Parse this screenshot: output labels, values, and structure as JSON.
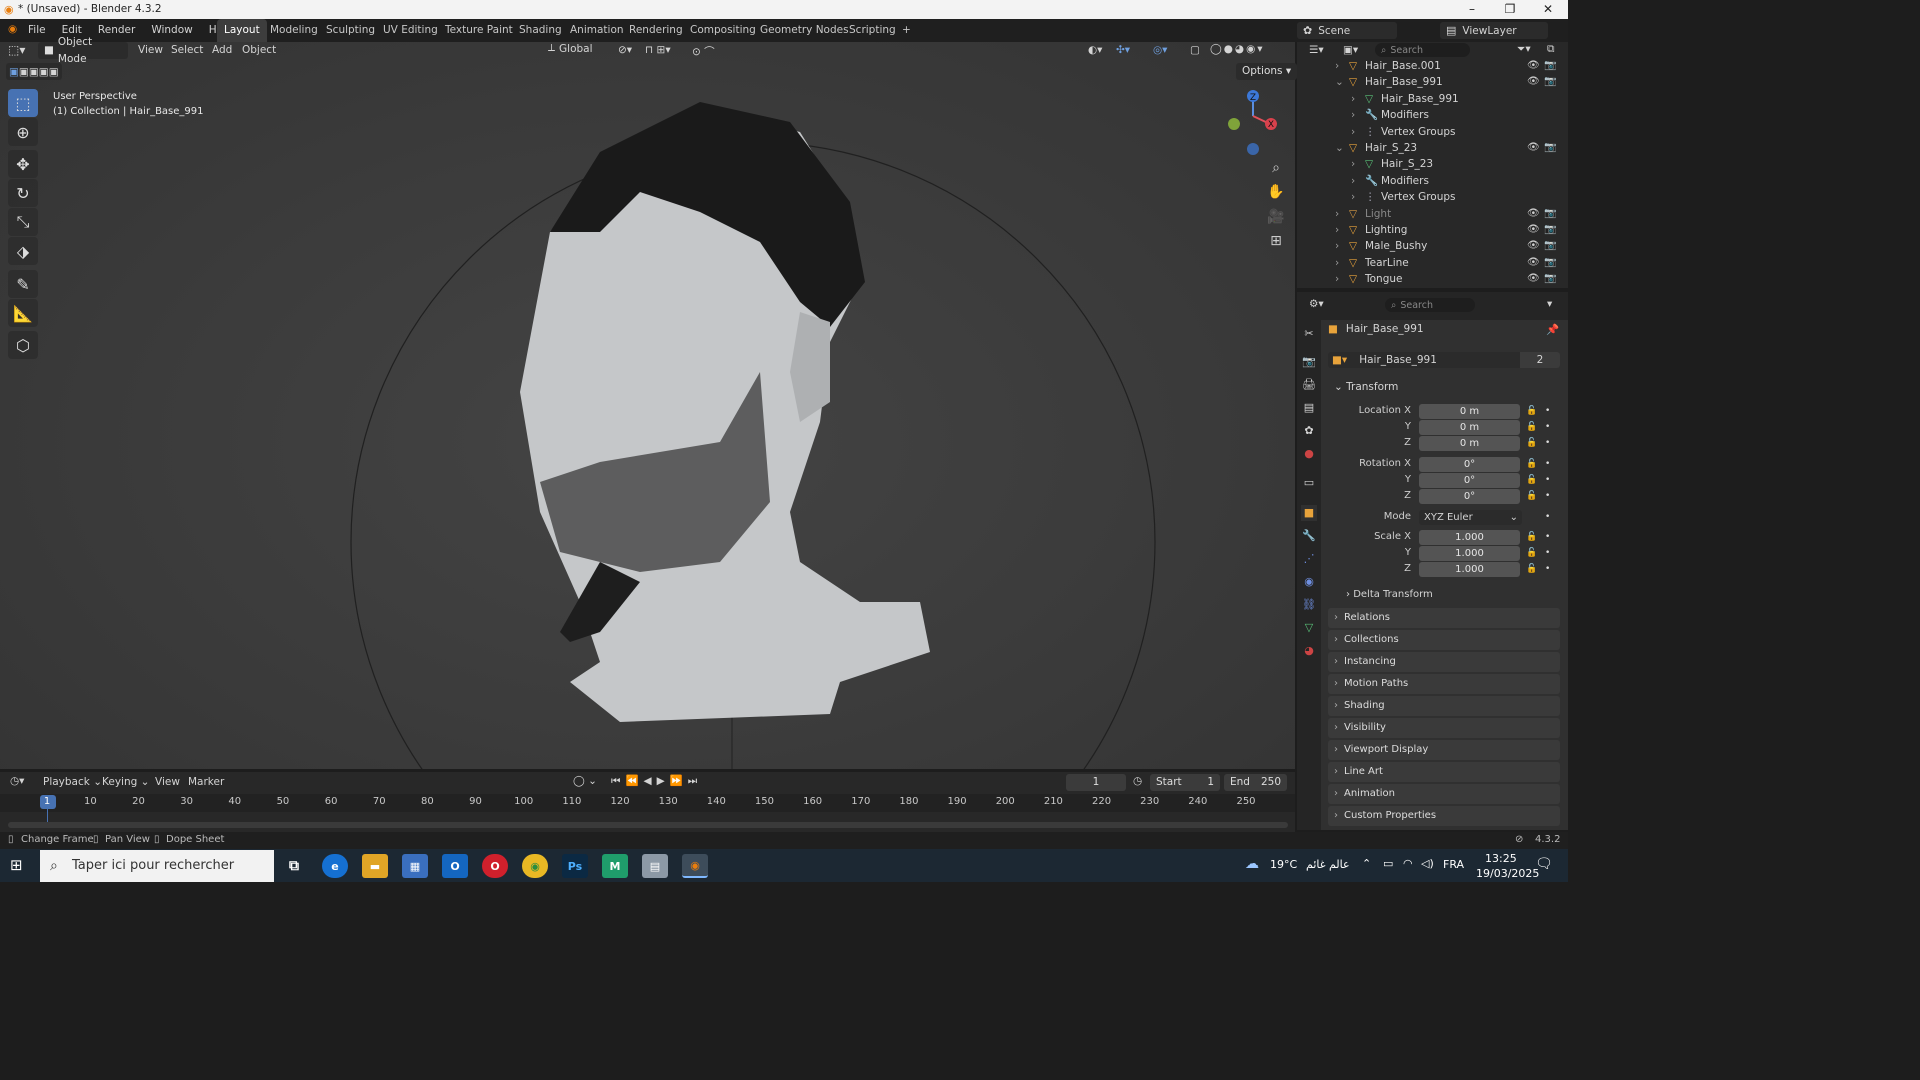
{
  "window": {
    "title": "* (Unsaved) - Blender 4.3.2",
    "minimize": "–",
    "maximize": "❐",
    "close": "✕"
  },
  "menu": [
    "File",
    "Edit",
    "Render",
    "Window",
    "Help"
  ],
  "workspaces": [
    "Layout",
    "Modeling",
    "Sculpting",
    "UV Editing",
    "Texture Paint",
    "Shading",
    "Animation",
    "Rendering",
    "Compositing",
    "Geometry Nodes",
    "Scripting",
    "+"
  ],
  "scene": {
    "name": "Scene",
    "viewlayer": "ViewLayer"
  },
  "viewport": {
    "mode": "Object Mode",
    "menus": [
      "View",
      "Select",
      "Add",
      "Object"
    ],
    "orientation": "Global",
    "options": "Options",
    "perspective": "User Perspective",
    "collection": "(1) Collection | Hair_Base_991",
    "gizmo": {
      "z": "Z",
      "x": "X"
    }
  },
  "outliner": {
    "search_placeholder": "Search",
    "rows": [
      {
        "label": "Hair_Base.001",
        "indent": 1,
        "expand": "›",
        "color": "#e8a33b"
      },
      {
        "label": "Hair_Base_991",
        "indent": 1,
        "expand": "⌄",
        "color": "#e8a33b"
      },
      {
        "label": "Hair_Base_991",
        "indent": 2,
        "expand": "›",
        "color": "#59c078"
      },
      {
        "label": "Modifiers",
        "indent": 2,
        "expand": "›",
        "color": "#6f8fe0"
      },
      {
        "label": "Vertex Groups",
        "indent": 2,
        "expand": "›",
        "color": "#aab"
      },
      {
        "label": "Hair_S_23",
        "indent": 1,
        "expand": "⌄",
        "color": "#e8a33b"
      },
      {
        "label": "Hair_S_23",
        "indent": 2,
        "expand": "›",
        "color": "#59c078"
      },
      {
        "label": "Modifiers",
        "indent": 2,
        "expand": "›",
        "color": "#6f8fe0"
      },
      {
        "label": "Vertex Groups",
        "indent": 2,
        "expand": "›",
        "color": "#aab"
      },
      {
        "label": "Light",
        "indent": 1,
        "expand": "›",
        "color": "#d79a45"
      },
      {
        "label": "Lighting",
        "indent": 1,
        "expand": "›",
        "color": "#e8a33b"
      },
      {
        "label": "Male_Bushy",
        "indent": 1,
        "expand": "›",
        "color": "#e8a33b"
      },
      {
        "label": "TearLine",
        "indent": 1,
        "expand": "›",
        "color": "#e8a33b"
      },
      {
        "label": "Tongue",
        "indent": 1,
        "expand": "›",
        "color": "#e8a33b"
      }
    ]
  },
  "properties": {
    "search_placeholder": "Search",
    "object_name": "Hair_Base_991",
    "datablock": "Hair_Base_991",
    "users": "2",
    "transform": {
      "title": "Transform",
      "location_label": "Location X",
      "loc": [
        "0 m",
        "0 m",
        "0 m"
      ],
      "rotation_label": "Rotation X",
      "rot": [
        "0°",
        "0°",
        "0°"
      ],
      "mode_label": "Mode",
      "mode": "XYZ Euler",
      "scale_label": "Scale X",
      "scale": [
        "1.000",
        "1.000",
        "1.000"
      ],
      "y": "Y",
      "z": "Z"
    },
    "delta": "Delta Transform",
    "panels": [
      "Relations",
      "Collections",
      "Instancing",
      "Motion Paths",
      "Shading",
      "Visibility",
      "Viewport Display",
      "Line Art",
      "Animation",
      "Custom Properties"
    ]
  },
  "timeline": {
    "menus": [
      "Playback",
      "Keying",
      "View",
      "Marker"
    ],
    "current_frame": "1",
    "start_label": "Start",
    "start": "1",
    "end_label": "End",
    "end": "250",
    "ticks": [
      "1",
      "10",
      "20",
      "30",
      "40",
      "50",
      "60",
      "70",
      "80",
      "90",
      "100",
      "110",
      "120",
      "130",
      "140",
      "150",
      "160",
      "170",
      "180",
      "190",
      "200",
      "210",
      "220",
      "230",
      "240",
      "250"
    ]
  },
  "status": {
    "items": [
      "Change Frame",
      "Pan View",
      "Dope Sheet"
    ],
    "version": "4.3.2"
  },
  "taskbar": {
    "search": "Taper ici pour rechercher",
    "weather": "19°C",
    "weather_text": "عالم غائم",
    "lang": "FRA",
    "time": "13:25",
    "date": "19/03/2025"
  }
}
